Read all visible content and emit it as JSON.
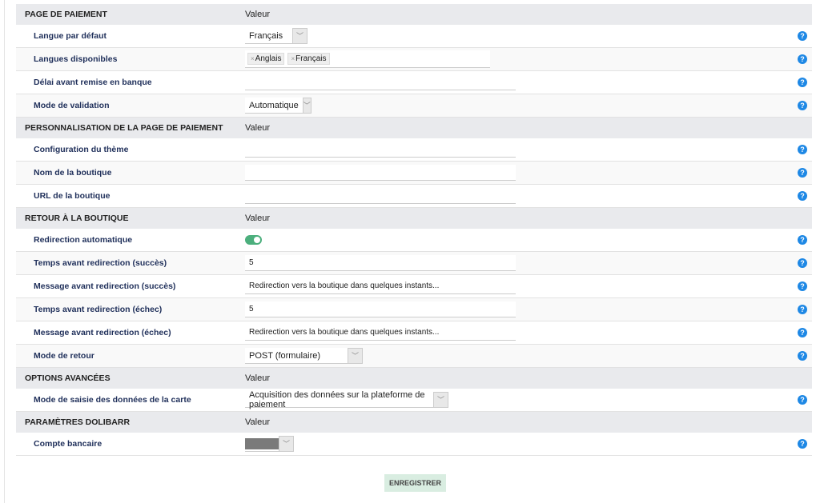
{
  "sections": [
    {
      "title": "PAGE DE PAIEMENT",
      "value_header": "Valeur",
      "rows": [
        {
          "label": "Langue par défaut",
          "value": "Français"
        },
        {
          "label": "Langues disponibles",
          "tags": [
            "Anglais",
            "Français"
          ]
        },
        {
          "label": "Délai avant remise en banque",
          "value": ""
        },
        {
          "label": "Mode de validation",
          "value": "Automatique"
        }
      ]
    },
    {
      "title": "PERSONNALISATION DE LA PAGE DE PAIEMENT",
      "value_header": "Valeur",
      "rows": [
        {
          "label": "Configuration du thème",
          "value": ""
        },
        {
          "label": "Nom de la boutique",
          "value": ""
        },
        {
          "label": "URL de la boutique",
          "value": ""
        }
      ]
    },
    {
      "title": "RETOUR À LA BOUTIQUE",
      "value_header": "Valeur",
      "rows": [
        {
          "label": "Redirection automatique",
          "enabled": true
        },
        {
          "label": "Temps avant redirection (succès)",
          "value": "5"
        },
        {
          "label": "Message avant redirection (succès)",
          "value": "Redirection vers la boutique dans quelques instants..."
        },
        {
          "label": "Temps avant redirection (échec)",
          "value": "5"
        },
        {
          "label": "Message avant redirection (échec)",
          "value": "Redirection vers la boutique dans quelques instants..."
        },
        {
          "label": "Mode de retour",
          "value": "POST (formulaire)"
        }
      ]
    },
    {
      "title": "OPTIONS AVANCÉES",
      "value_header": "Valeur",
      "rows": [
        {
          "label": "Mode de saisie des données de la carte",
          "value": "Acquisition des données sur la plateforme de paiement"
        }
      ]
    },
    {
      "title": "PARAMÈTRES DOLIBARR",
      "value_header": "Valeur",
      "rows": [
        {
          "label": "Compte bancaire",
          "value": ""
        }
      ]
    }
  ],
  "tag_remove": "×",
  "help": "?",
  "chevron": "﹀",
  "save_label": "ENREGISTRER",
  "colors": {
    "toggle_on": "#4caf7d",
    "help": "#1e88e5",
    "header_bg": "#e9eaed",
    "button_bg": "#d9ede1"
  }
}
